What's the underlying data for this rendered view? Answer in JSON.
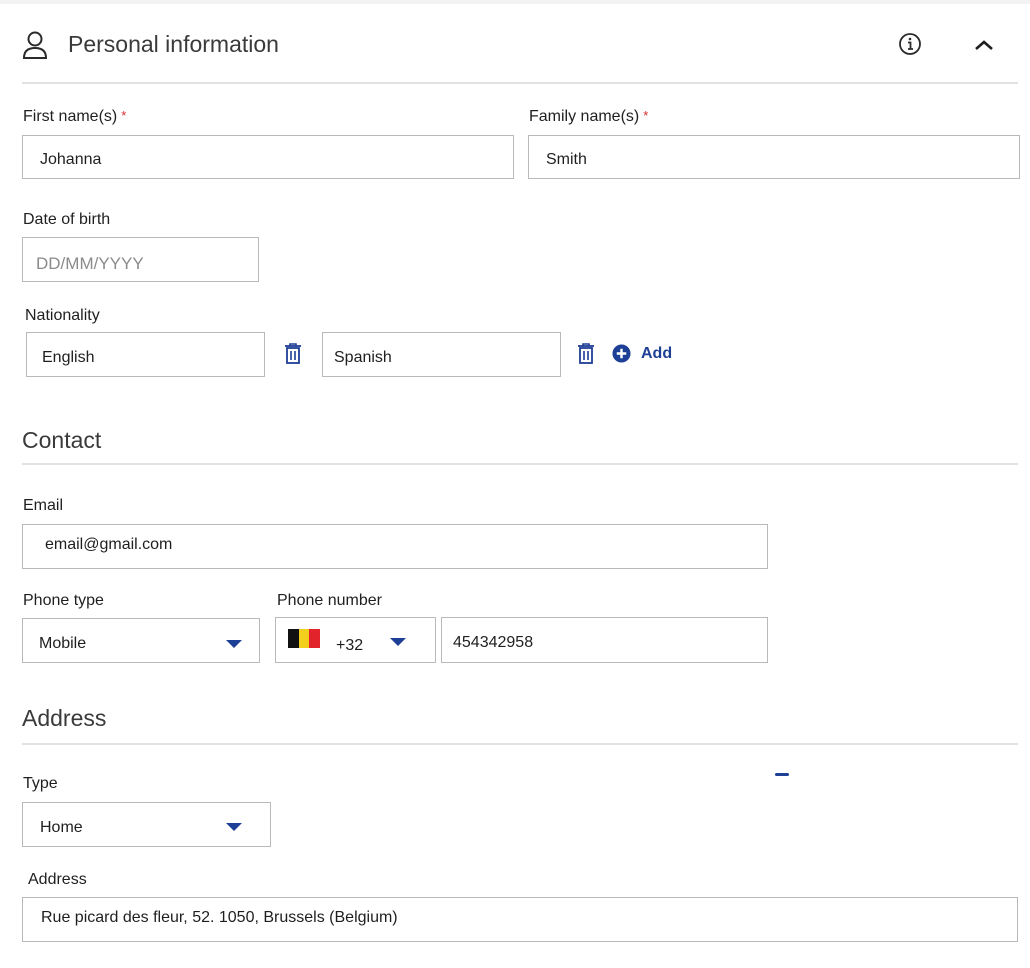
{
  "personal": {
    "section_title": "Personal information",
    "first_name_label": "First name(s)",
    "first_name_value": "Johanna",
    "family_name_label": "Family name(s)",
    "family_name_value": "Smith",
    "required_mark": "*",
    "dob_label": "Date of birth",
    "dob_placeholder": "DD/MM/YYYY",
    "nationality_label": "Nationality",
    "nationalities": [
      "English",
      "Spanish"
    ],
    "add_label": "Add"
  },
  "contact": {
    "section_title": "Contact",
    "email_label": "Email",
    "email_value": "email@gmail.com",
    "phone_type_label": "Phone type",
    "phone_type_value": "Mobile",
    "phone_number_label": "Phone number",
    "country_code": "+32",
    "phone_number_value": "454342958"
  },
  "address": {
    "section_title": "Address",
    "type_label": "Type",
    "type_value": "Home",
    "address_label": "Address",
    "address_value": "Rue picard des fleur, 52. 1050, Brussels (Belgium)"
  },
  "colors": {
    "accent": "#1e3f96",
    "required": "#d62828",
    "border": "#b9b9b9",
    "divider": "#e2e2e2"
  },
  "icons": [
    "user-icon",
    "info-icon",
    "chevron-up-icon",
    "trash-icon",
    "plus-circle-icon",
    "caret-down-icon",
    "belgium-flag-icon"
  ]
}
